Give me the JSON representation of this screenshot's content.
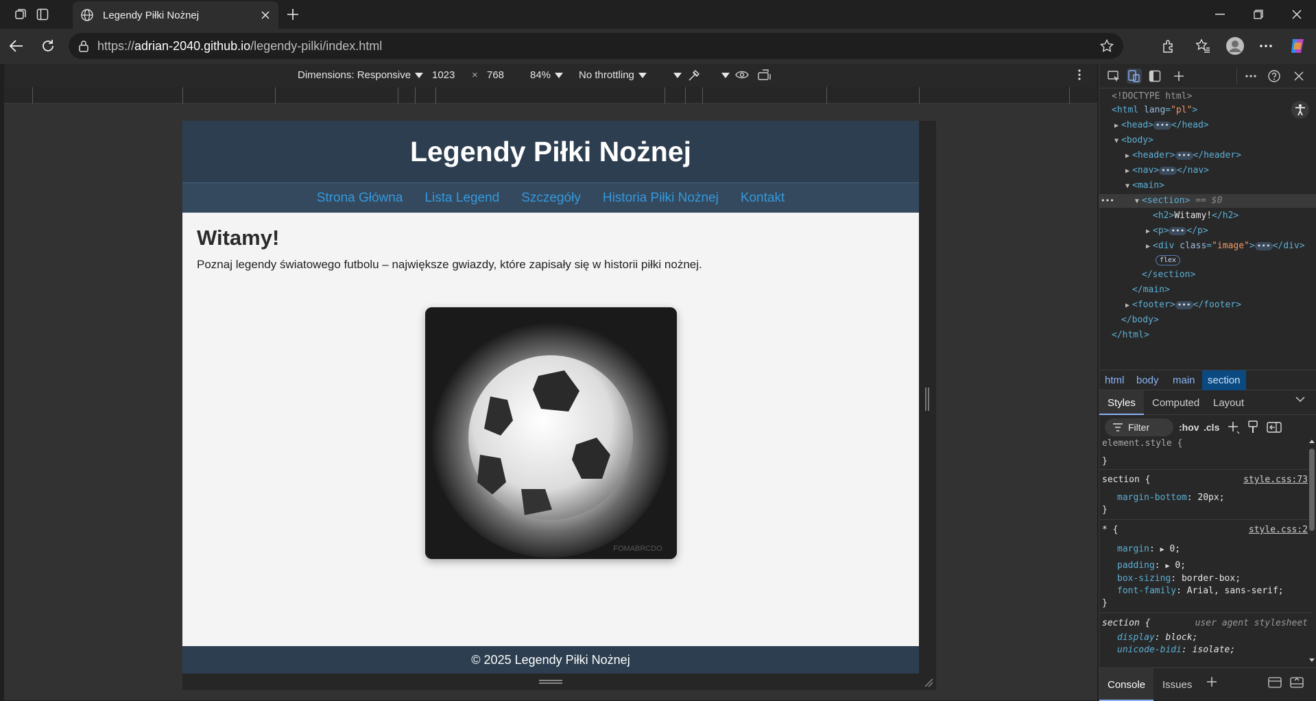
{
  "browser": {
    "tab_title": "Legendy Piłki Nożnej",
    "url_prefix": "https://",
    "url_host": "adrian-2040.github.io",
    "url_path": "/legendy-pilki/index.html"
  },
  "device_toolbar": {
    "dimensions_label": "Dimensions: Responsive",
    "width": "1023",
    "times": "×",
    "height": "768",
    "zoom": "84%",
    "throttling": "No throttling"
  },
  "page": {
    "header_title": "Legendy Piłki Nożnej",
    "nav": [
      "Strona Główna",
      "Lista Legend",
      "Szczegóły",
      "Historia Piłki Nożnej",
      "Kontakt"
    ],
    "heading": "Witamy!",
    "intro": "Poznaj legendy światowego futbolu – największe gwiazdy, które zapisały się w historii piłki nożnej.",
    "footer": "© 2025 Legendy Piłki Nożnej",
    "image_watermark": "FOMABRCDO"
  },
  "devtools": {
    "dom": {
      "doctype": "<!DOCTYPE html>",
      "html_open_tag": "<html",
      "html_attr_name": "lang",
      "html_attr_value": "\"pl\"",
      "head": "<head>",
      "head_close": "</head>",
      "body_open": "<body>",
      "header": "<header>",
      "header_close": "</header>",
      "nav": "<nav>",
      "nav_close": "</nav>",
      "main_open": "<main>",
      "section_open": "<section>",
      "section_eq": "== $0",
      "h2_open": "<h2>",
      "h2_text": "Witamy!",
      "h2_close": "</h2>",
      "p_open": "<p>",
      "p_close": "</p>",
      "div_open": "<div",
      "div_attr_name": "class",
      "div_attr_value": "\"image\"",
      "div_close": "</div>",
      "flex_badge": "flex",
      "section_close": "</section>",
      "main_close": "</main>",
      "footer": "<footer>",
      "footer_close": "</footer>",
      "body_close": "</body>",
      "html_close": "</html>",
      "ellipsis": "•••"
    },
    "breadcrumbs": [
      "html",
      "body",
      "main",
      "section"
    ],
    "style_tabs": [
      "Styles",
      "Computed",
      "Layout"
    ],
    "filter_placeholder": "Filter",
    "hov": ":hov",
    "cls": ".cls",
    "rules": {
      "element_style": "element.style {",
      "close": "}",
      "section_sel": "section {",
      "section_src": "style.css:73",
      "margin_bottom_prop": "margin-bottom",
      "margin_bottom_val": "20px;",
      "star_sel": "* {",
      "star_src": "style.css:2",
      "margin_prop": "margin",
      "margin_val": "0;",
      "padding_prop": "padding",
      "padding_val": "0;",
      "box_sizing_prop": "box-sizing",
      "box_sizing_val": "border-box;",
      "font_family_prop": "font-family",
      "font_family_val": "Arial, sans-serif;",
      "ua_sel": "section {",
      "ua_src": "user agent stylesheet",
      "display_prop": "display",
      "display_val": "block;",
      "unicode_prop": "unicode-bidi",
      "unicode_val": "isolate;"
    },
    "bottom_tabs": [
      "Console",
      "Issues"
    ]
  }
}
